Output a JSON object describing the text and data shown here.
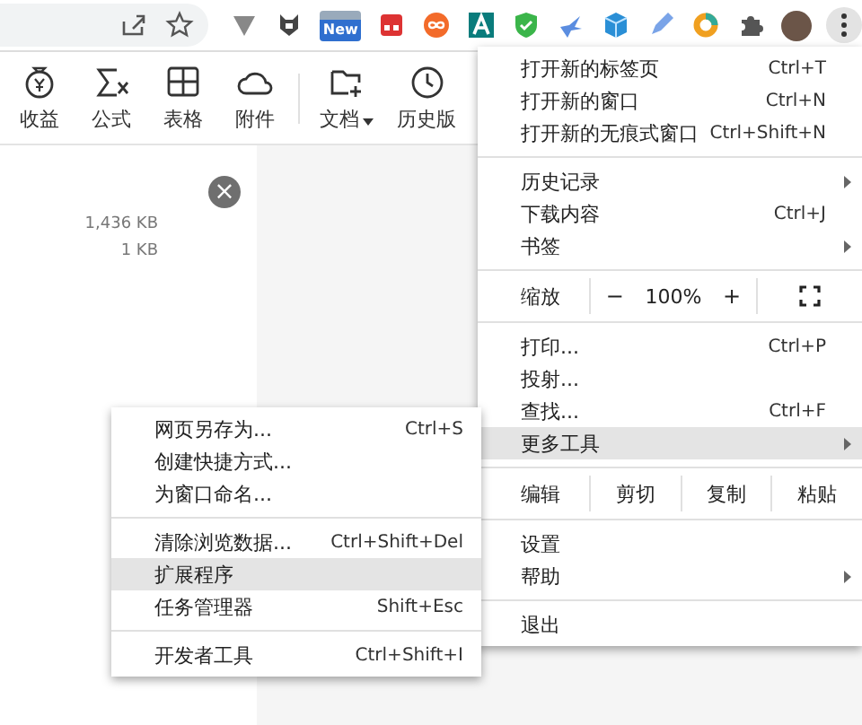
{
  "browser": {
    "extension_badge": "New"
  },
  "toolbar": [
    {
      "label": "收益",
      "dropdown": false
    },
    {
      "label": "公式",
      "dropdown": false
    },
    {
      "label": "表格",
      "dropdown": false
    },
    {
      "label": "附件",
      "dropdown": false
    },
    {
      "label": "文档",
      "dropdown": true
    },
    {
      "label": "历史版",
      "dropdown": false
    }
  ],
  "files": [
    {
      "size": "1,436 KB"
    },
    {
      "size": "1 KB"
    }
  ],
  "close_button": "×",
  "menu": [
    {
      "kind": "item",
      "label": "打开新的标签页",
      "shortcut": "Ctrl+T",
      "submenu": false,
      "selected": false
    },
    {
      "kind": "item",
      "label": "打开新的窗口",
      "shortcut": "Ctrl+N",
      "submenu": false,
      "selected": false
    },
    {
      "kind": "item",
      "label": "打开新的无痕式窗口",
      "shortcut": "Ctrl+Shift+N",
      "submenu": false,
      "selected": false
    },
    {
      "kind": "separator"
    },
    {
      "kind": "item",
      "label": "历史记录",
      "submenu": true,
      "selected": false
    },
    {
      "kind": "item",
      "label": "下载内容",
      "shortcut": "Ctrl+J",
      "submenu": false,
      "selected": false
    },
    {
      "kind": "item",
      "label": "书签",
      "submenu": true,
      "selected": false
    },
    {
      "kind": "separator"
    },
    {
      "kind": "zoom",
      "label": "缩放",
      "minus": "−",
      "value": "100%",
      "plus": "+"
    },
    {
      "kind": "separator"
    },
    {
      "kind": "item",
      "label": "打印...",
      "shortcut": "Ctrl+P",
      "submenu": false,
      "selected": false
    },
    {
      "kind": "item",
      "label": "投射...",
      "submenu": false,
      "selected": false
    },
    {
      "kind": "item",
      "label": "查找...",
      "shortcut": "Ctrl+F",
      "submenu": false,
      "selected": false
    },
    {
      "kind": "item",
      "label": "更多工具",
      "submenu": true,
      "selected": true
    },
    {
      "kind": "separator"
    },
    {
      "kind": "edit",
      "label": "编辑",
      "buttons": [
        "剪切",
        "复制",
        "粘贴"
      ]
    },
    {
      "kind": "separator"
    },
    {
      "kind": "item",
      "label": "设置",
      "submenu": false,
      "selected": false
    },
    {
      "kind": "item",
      "label": "帮助",
      "submenu": true,
      "selected": false
    },
    {
      "kind": "separator"
    },
    {
      "kind": "item",
      "label": "退出",
      "submenu": false,
      "selected": false
    }
  ],
  "submenu": [
    {
      "kind": "item",
      "label": "网页另存为...",
      "shortcut": "Ctrl+S",
      "selected": false
    },
    {
      "kind": "item",
      "label": "创建快捷方式...",
      "selected": false
    },
    {
      "kind": "item",
      "label": "为窗口命名...",
      "selected": false
    },
    {
      "kind": "separator"
    },
    {
      "kind": "item",
      "label": "清除浏览数据...",
      "shortcut": "Ctrl+Shift+Del",
      "selected": false
    },
    {
      "kind": "item",
      "label": "扩展程序",
      "selected": true
    },
    {
      "kind": "item",
      "label": "任务管理器",
      "shortcut": "Shift+Esc",
      "selected": false
    },
    {
      "kind": "separator"
    },
    {
      "kind": "item",
      "label": "开发者工具",
      "shortcut": "Ctrl+Shift+I",
      "selected": false
    }
  ]
}
